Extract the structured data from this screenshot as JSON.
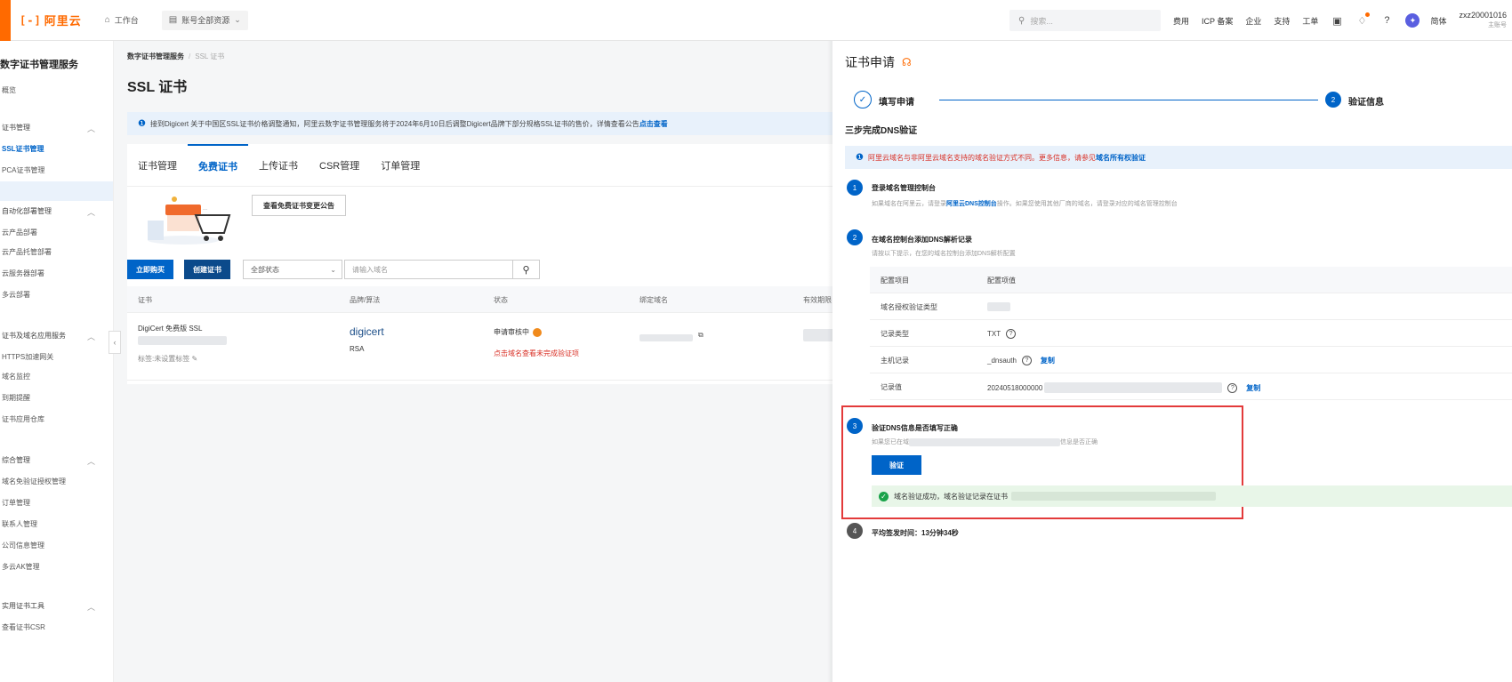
{
  "topbar": {
    "logo_glyph": "[-]",
    "logo_text": "阿里云",
    "workbench": "工作台",
    "account_resources": "账号全部资源",
    "search_placeholder": "搜索...",
    "links": [
      "费用",
      "ICP 备案",
      "企业",
      "支持",
      "工单"
    ],
    "lang": "简体",
    "username": "zxz20001016",
    "role": "主账号"
  },
  "sidebar": {
    "title": "数字证书管理服务",
    "items": [
      {
        "label": "概览",
        "type": "item"
      },
      {
        "label": "证书管理",
        "type": "group"
      },
      {
        "label": "SSL证书管理",
        "type": "active"
      },
      {
        "label": "PCA证书管理",
        "type": "item"
      },
      {
        "label": "自动化部署管理",
        "type": "group"
      },
      {
        "label": "云产品部署",
        "type": "item"
      },
      {
        "label": "云产品托管部署",
        "type": "item"
      },
      {
        "label": "云服务器部署",
        "type": "item"
      },
      {
        "label": "多云部署",
        "type": "item"
      },
      {
        "label": "证书及域名应用服务",
        "type": "group"
      },
      {
        "label": "HTTPS加速网关",
        "type": "item"
      },
      {
        "label": "域名监控",
        "type": "item"
      },
      {
        "label": "到期提醒",
        "type": "item"
      },
      {
        "label": "证书应用仓库",
        "type": "item"
      },
      {
        "label": "综合管理",
        "type": "group"
      },
      {
        "label": "域名免验证授权管理",
        "type": "item"
      },
      {
        "label": "订单管理",
        "type": "item"
      },
      {
        "label": "联系人管理",
        "type": "item"
      },
      {
        "label": "公司信息管理",
        "type": "item"
      },
      {
        "label": "多云AK管理",
        "type": "item"
      },
      {
        "label": "实用证书工具",
        "type": "group"
      },
      {
        "label": "查看证书CSR",
        "type": "item"
      }
    ]
  },
  "main": {
    "breadcrumb_root": "数字证书管理服务",
    "breadcrumb_current": "SSL 证书",
    "title": "SSL 证书",
    "notice_text": "接到Digicert 关于中国区SSL证书价格调整通知，阿里云数字证书管理服务将于2024年6月10日后调整Digicert品牌下部分规格SSL证书的售价，详情查看公告",
    "notice_link": "点击查看",
    "tabs": [
      "证书管理",
      "免费证书",
      "上传证书",
      "CSR管理",
      "订单管理"
    ],
    "promo_button": "查看免费证书变更公告",
    "buy_button": "立即购买",
    "create_button": "创建证书",
    "status_select": "全部状态",
    "domain_placeholder": "请输入域名",
    "columns": [
      "证书",
      "品牌/算法",
      "状态",
      "绑定域名",
      "有效期限"
    ],
    "row": {
      "cert_name": "DigiCert 免费版 SSL",
      "tag_hint": "标签:未设置标签",
      "brand": "digicert",
      "algo": "RSA",
      "status": "申请审核中",
      "status_hint": "点击域名查看未完成验证项"
    }
  },
  "drawer": {
    "title": "证书申请",
    "step1": "填写申请",
    "step2_num": "2",
    "step2": "验证信息",
    "sub_head": "三步完成DNS验证",
    "notice_text": "阿里云域名与非阿里云域名支持的域名验证方式不同。更多信息，请参见",
    "notice_link": "域名所有权验证",
    "s1_num": "1",
    "s1_title": "登录域名管理控制台",
    "s1_desc_a": "如果域名在阿里云，请登录",
    "s1_desc_link": "阿里云DNS控制台",
    "s1_desc_b": "操作。如果您使用其他厂商的域名，请登录对应的域名管理控制台",
    "s2_num": "2",
    "s2_title": "在域名控制台添加DNS解析记录",
    "s2_desc": "请按以下提示，在您的域名控制台添加DNS解析配置",
    "table": {
      "head": [
        "配置项目",
        "配置项值"
      ],
      "rows": [
        {
          "k": "域名授权验证类型",
          "v": ""
        },
        {
          "k": "记录类型",
          "v": "TXT"
        },
        {
          "k": "主机记录",
          "v": "_dnsauth"
        },
        {
          "k": "记录值",
          "v": "20240518000000"
        }
      ],
      "copy": "复制"
    },
    "s3_num": "3",
    "s3_title": "验证DNS信息是否填写正确",
    "s3_desc_a": "如果您已在域",
    "s3_desc_b": "信息是否正确",
    "verify_button": "验证",
    "success_text": "域名验证成功，域名验证记录在证书",
    "s4_num": "4",
    "avg_time": "平均签发时间：13分钟34秒"
  },
  "colors": {
    "brand": "#ff6a00",
    "primary": "#0064c8",
    "highlight_border": "#e33a3a",
    "success": "#1aa34a"
  }
}
